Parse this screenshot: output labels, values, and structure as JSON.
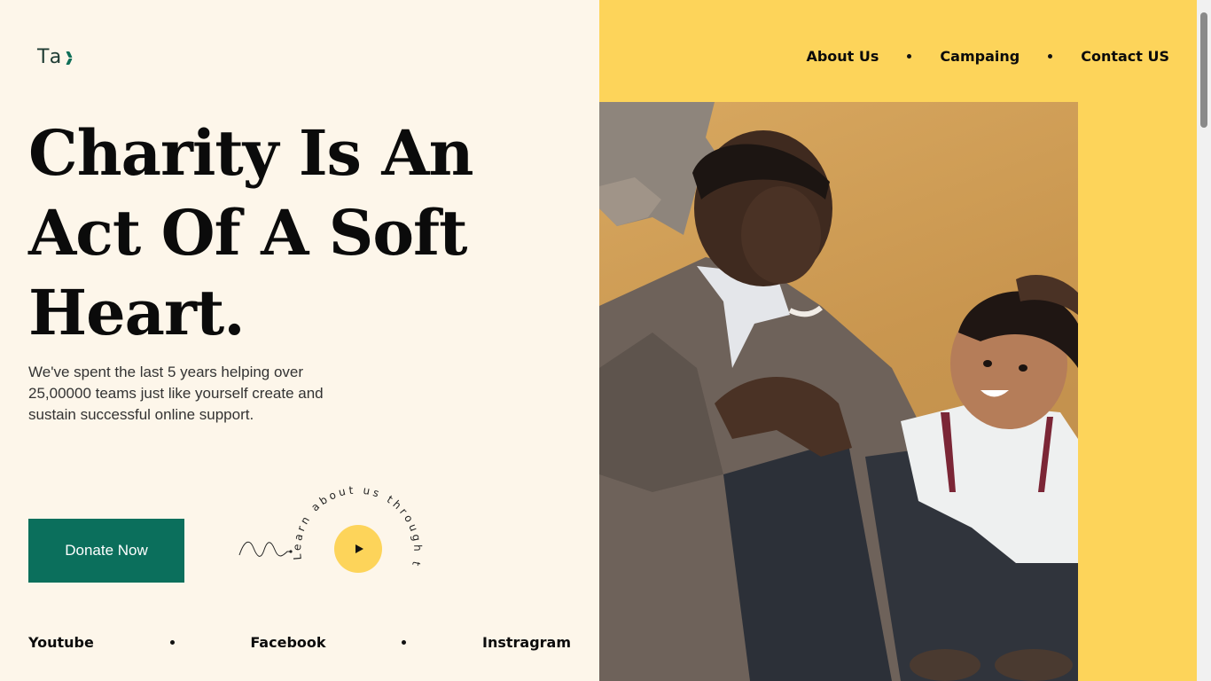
{
  "logo": {
    "text": "Ta"
  },
  "nav": {
    "items": [
      {
        "label": "About Us"
      },
      {
        "label": "Campaing"
      },
      {
        "label": "Contact US"
      }
    ]
  },
  "hero": {
    "title_lines": [
      "Charity Is An",
      "Act Of A Soft",
      "Heart."
    ],
    "subtitle": "We've spent the last 5 years helping over 25,00000 teams just like yourself create and sustain successful online support.",
    "donate_label": "Donate Now",
    "video_circle_text": "Learn about us through this video"
  },
  "social": {
    "items": [
      {
        "label": "Youtube"
      },
      {
        "label": "Facebook"
      },
      {
        "label": "Instragram"
      }
    ]
  },
  "colors": {
    "page_bg": "#fdf6ea",
    "accent_yellow": "#fdd45a",
    "brand_green": "#0b6f5c"
  },
  "icons": [
    "logo-mark-icon",
    "squiggle-arrow-icon",
    "play-icon"
  ]
}
